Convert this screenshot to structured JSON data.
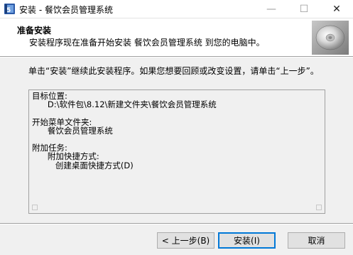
{
  "window": {
    "title": "安装 - 餐饮会员管理系统",
    "minimize_glyph": "—",
    "maximize_glyph": "☐",
    "close_glyph": "✕"
  },
  "header": {
    "title": "准备安装",
    "subtitle": "安装程序现在准备开始安装 餐饮会员管理系统 到您的电脑中。"
  },
  "body": {
    "description": "单击“安装”继续此安装程序。如果您想要回顾或改变设置，请单击“上一步”。",
    "summary": "目标位置:\n      D:\\软件包\\8.12\\新建文件夹\\餐饮会员管理系统\n\n开始菜单文件夹:\n      餐饮会员管理系统\n\n附加任务:\n      附加快捷方式:\n         创建桌面快捷方式(D)"
  },
  "buttons": {
    "back": "< 上一步(B)",
    "install": "安装(I)",
    "cancel": "取消"
  }
}
